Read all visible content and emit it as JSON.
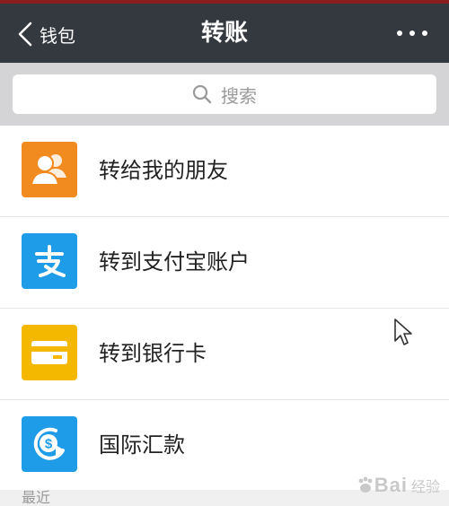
{
  "header": {
    "back_label": "钱包",
    "title": "转账",
    "more_icon": "more-icon"
  },
  "search": {
    "placeholder": "搜索"
  },
  "options": [
    {
      "label": "转给我的朋友",
      "icon": "friends-icon",
      "color": "#f18a1f"
    },
    {
      "label": "转到支付宝账户",
      "icon": "alipay-icon",
      "color": "#1e9ce8"
    },
    {
      "label": "转到银行卡",
      "icon": "bank-card-icon",
      "color": "#f5b800"
    },
    {
      "label": "国际汇款",
      "icon": "international-remittance-icon",
      "color": "#1e9ce8"
    }
  ],
  "recent": {
    "label": "最近"
  },
  "watermark": {
    "text": "Bai",
    "sub": "经验"
  },
  "colors": {
    "navbar": "#34383f",
    "search_area": "#d4d4d6",
    "accent_red": "#8a1d1d"
  }
}
